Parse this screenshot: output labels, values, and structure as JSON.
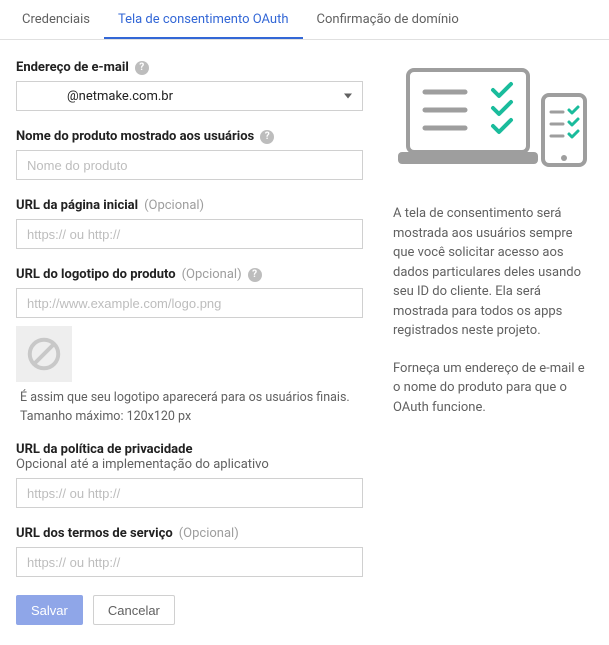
{
  "tabs": {
    "credentials": "Credenciais",
    "consent": "Tela de consentimento OAuth",
    "domain": "Confirmação de domínio"
  },
  "form": {
    "email": {
      "label": "Endereço de e-mail",
      "value": "@netmake.com.br"
    },
    "productName": {
      "label": "Nome do produto mostrado aos usuários",
      "placeholder": "Nome do produto"
    },
    "homepageUrl": {
      "label": "URL da página inicial",
      "optional": "(Opcional)",
      "placeholder": "https:// ou http://"
    },
    "logoUrl": {
      "label": "URL do logotipo do produto",
      "optional": "(Opcional)",
      "placeholder": "http://www.example.com/logo.png",
      "note1": "É assim que seu logotipo aparecerá para os usuários finais.",
      "note2": "Tamanho máximo: 120x120 px"
    },
    "privacyUrl": {
      "label": "URL da política de privacidade",
      "sublabel": "Opcional até a implementação do aplicativo",
      "placeholder": "https:// ou http://"
    },
    "tosUrl": {
      "label": "URL dos termos de serviço",
      "optional": "(Opcional)",
      "placeholder": "https:// ou http://"
    }
  },
  "buttons": {
    "save": "Salvar",
    "cancel": "Cancelar"
  },
  "side": {
    "para1": "A tela de consentimento será mostrada aos usuários sempre que você solicitar acesso aos dados particulares deles usando seu ID do cliente. Ela será mostrada para todos os apps registrados neste projeto.",
    "para2": "Forneça um endereço de e-mail e o nome do produto para que o OAuth funcione."
  }
}
